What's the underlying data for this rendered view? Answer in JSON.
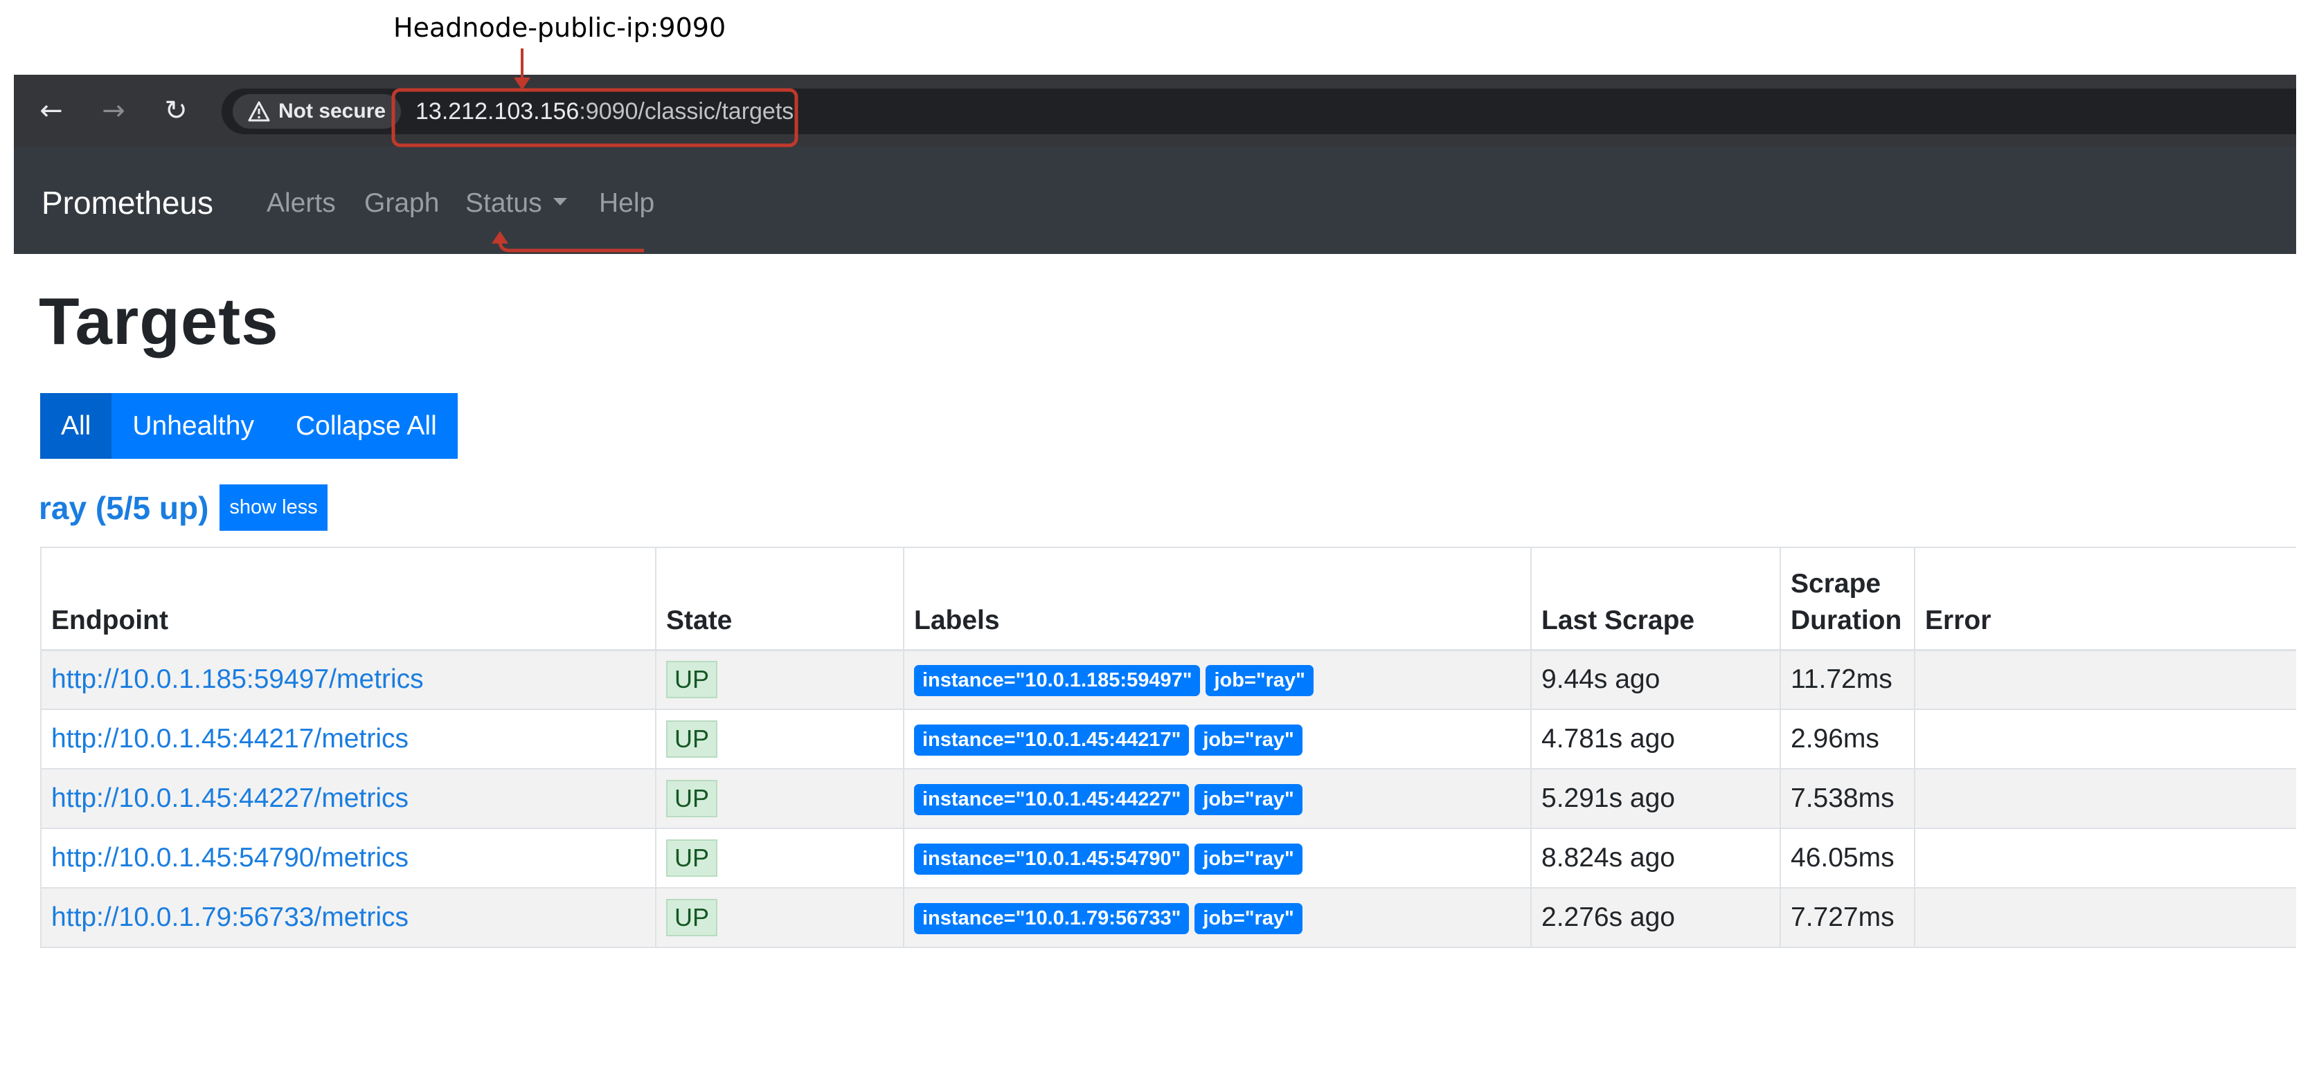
{
  "annotation": {
    "text": "Headnode-public-ip:9090",
    "color": "#c0392b"
  },
  "browser": {
    "security_label": "Not secure",
    "url_host": "13.212.103.156",
    "url_path": ":9090/classic/targets"
  },
  "navbar": {
    "brand": "Prometheus",
    "links": [
      "Alerts",
      "Graph",
      "Status",
      "Help"
    ]
  },
  "page": {
    "title": "Targets",
    "filters": [
      "All",
      "Unhealthy",
      "Collapse All"
    ],
    "active_filter": "All"
  },
  "job": {
    "title": "ray (5/5 up)",
    "toggle_label": "show less"
  },
  "table": {
    "headers": [
      "Endpoint",
      "State",
      "Labels",
      "Last Scrape",
      "Scrape Duration",
      "Error"
    ],
    "rows": [
      {
        "endpoint": "http://10.0.1.185:59497/metrics",
        "state": "UP",
        "labels": [
          "instance=\"10.0.1.185:59497\"",
          "job=\"ray\""
        ],
        "last_scrape": "9.44s ago",
        "duration": "11.72ms",
        "error": ""
      },
      {
        "endpoint": "http://10.0.1.45:44217/metrics",
        "state": "UP",
        "labels": [
          "instance=\"10.0.1.45:44217\"",
          "job=\"ray\""
        ],
        "last_scrape": "4.781s ago",
        "duration": "2.96ms",
        "error": ""
      },
      {
        "endpoint": "http://10.0.1.45:44227/metrics",
        "state": "UP",
        "labels": [
          "instance=\"10.0.1.45:44227\"",
          "job=\"ray\""
        ],
        "last_scrape": "5.291s ago",
        "duration": "7.538ms",
        "error": ""
      },
      {
        "endpoint": "http://10.0.1.45:54790/metrics",
        "state": "UP",
        "labels": [
          "instance=\"10.0.1.45:54790\"",
          "job=\"ray\""
        ],
        "last_scrape": "8.824s ago",
        "duration": "46.05ms",
        "error": ""
      },
      {
        "endpoint": "http://10.0.1.79:56733/metrics",
        "state": "UP",
        "labels": [
          "instance=\"10.0.1.79:56733\"",
          "job=\"ray\""
        ],
        "last_scrape": "2.276s ago",
        "duration": "7.727ms",
        "error": ""
      }
    ]
  },
  "icons": {
    "back": "arrow-left-icon",
    "forward": "arrow-right-icon",
    "reload": "reload-icon",
    "warning": "warning-icon",
    "status_caret": "caret-down-icon"
  }
}
